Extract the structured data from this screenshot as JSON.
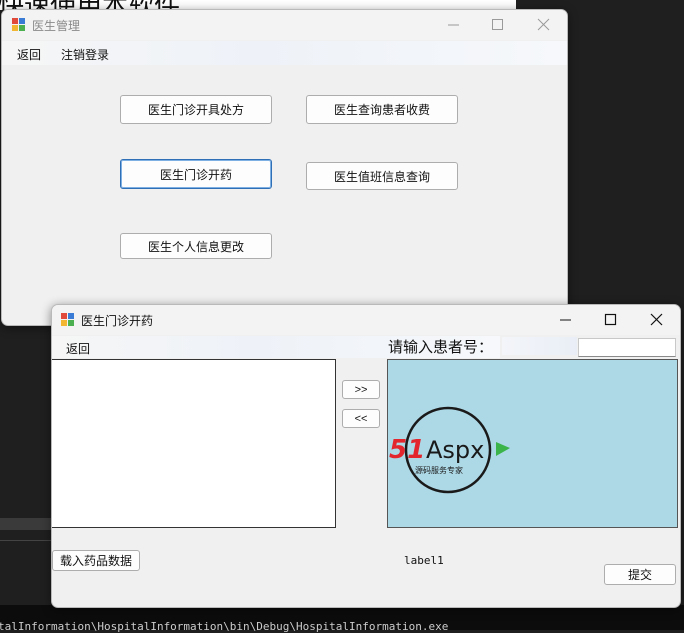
{
  "background_console": {
    "top_text": "快速使用本软件",
    "bottom_path": "talInformation\\HospitalInformation\\bin\\Debug\\HospitalInformation.exe"
  },
  "doctor_window": {
    "title": "医生管理",
    "menu": [
      "返回",
      "注销登录"
    ],
    "buttons": {
      "prescription": "医生门诊开具处方",
      "query_charge": "医生查询患者收费",
      "dispense": "医生门诊开药",
      "duty_query": "医生值班信息查询",
      "profile_edit": "医生个人信息更改"
    }
  },
  "dispense_window": {
    "title": "医生门诊开药",
    "menu_back": "返回",
    "patient_prompt": "请输入患者号：",
    "patient_input_value": "",
    "move_right": ">>",
    "move_left": "<<",
    "logo": {
      "brand_51": "51",
      "brand_aspx": "Aspx",
      "tagline": "源码服务专家"
    },
    "load_button": "载入药品数据",
    "label1": "label1",
    "submit_button": "提交"
  },
  "colors": {
    "picture_bg": "#add8e6",
    "logo_red": "#e3262d",
    "logo_green": "#3bb54a",
    "focus_border": "#2f6fb5"
  },
  "icons": {
    "app": "winforms-app-icon",
    "minimize": "minimize-icon",
    "maximize": "maximize-icon",
    "close": "close-icon"
  }
}
